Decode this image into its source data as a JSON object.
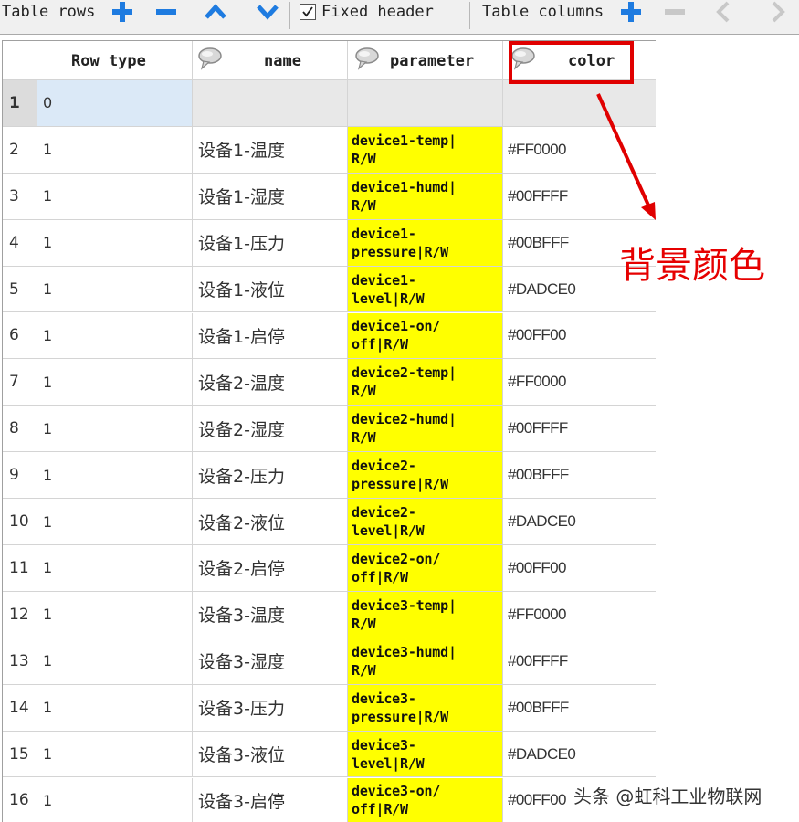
{
  "toolbar": {
    "table_rows_label": "Table rows",
    "fixed_header_label": "Fixed header",
    "fixed_header_checked": true,
    "table_columns_label": "Table columns",
    "icons": [
      "add-row-icon",
      "remove-row-icon",
      "move-up-icon",
      "move-down-icon",
      "add-column-icon",
      "remove-column-icon",
      "move-left-icon",
      "move-right-icon"
    ]
  },
  "table": {
    "headers": {
      "row_type": "Row type",
      "name": "name",
      "parameter": "parameter",
      "color": "color"
    },
    "rows": [
      {
        "num": "1",
        "type": "0",
        "name": "",
        "parameter": "",
        "color": ""
      },
      {
        "num": "2",
        "type": "1",
        "name": "设备1-温度",
        "parameter": "device1-temp|\nR/W",
        "color": "#FF0000"
      },
      {
        "num": "3",
        "type": "1",
        "name": "设备1-湿度",
        "parameter": "device1-humd|\nR/W",
        "color": "#00FFFF"
      },
      {
        "num": "4",
        "type": "1",
        "name": "设备1-压力",
        "parameter": "device1-\npressure|R/W",
        "color": "#00BFFF"
      },
      {
        "num": "5",
        "type": "1",
        "name": "设备1-液位",
        "parameter": "device1-\nlevel|R/W",
        "color": "#DADCE0"
      },
      {
        "num": "6",
        "type": "1",
        "name": "设备1-启停",
        "parameter": "device1-on/\noff|R/W",
        "color": "#00FF00"
      },
      {
        "num": "7",
        "type": "1",
        "name": "设备2-温度",
        "parameter": "device2-temp|\nR/W",
        "color": "#FF0000"
      },
      {
        "num": "8",
        "type": "1",
        "name": "设备2-湿度",
        "parameter": "device2-humd|\nR/W",
        "color": "#00FFFF"
      },
      {
        "num": "9",
        "type": "1",
        "name": "设备2-压力",
        "parameter": "device2-\npressure|R/W",
        "color": "#00BFFF"
      },
      {
        "num": "10",
        "type": "1",
        "name": "设备2-液位",
        "parameter": "device2-\nlevel|R/W",
        "color": "#DADCE0"
      },
      {
        "num": "11",
        "type": "1",
        "name": "设备2-启停",
        "parameter": "device2-on/\noff|R/W",
        "color": "#00FF00"
      },
      {
        "num": "12",
        "type": "1",
        "name": "设备3-温度",
        "parameter": "device3-temp|\nR/W",
        "color": "#FF0000"
      },
      {
        "num": "13",
        "type": "1",
        "name": "设备3-湿度",
        "parameter": "device3-humd|\nR/W",
        "color": "#00FFFF"
      },
      {
        "num": "14",
        "type": "1",
        "name": "设备3-压力",
        "parameter": "device3-\npressure|R/W",
        "color": "#00BFFF"
      },
      {
        "num": "15",
        "type": "1",
        "name": "设备3-液位",
        "parameter": "device3-\nlevel|R/W",
        "color": "#DADCE0"
      },
      {
        "num": "16",
        "type": "1",
        "name": "设备3-启停",
        "parameter": "device3-on/\noff|R/W",
        "color": "#00FF00"
      }
    ]
  },
  "annotation": {
    "text": "背景颜色",
    "color": "#e60000"
  },
  "watermark": "头条 @虹科工业物联网",
  "colors": {
    "accent_blue": "#1e7be0",
    "parameter_bg": "#ffff00",
    "toolbar_bg": "#f0f0f0"
  }
}
